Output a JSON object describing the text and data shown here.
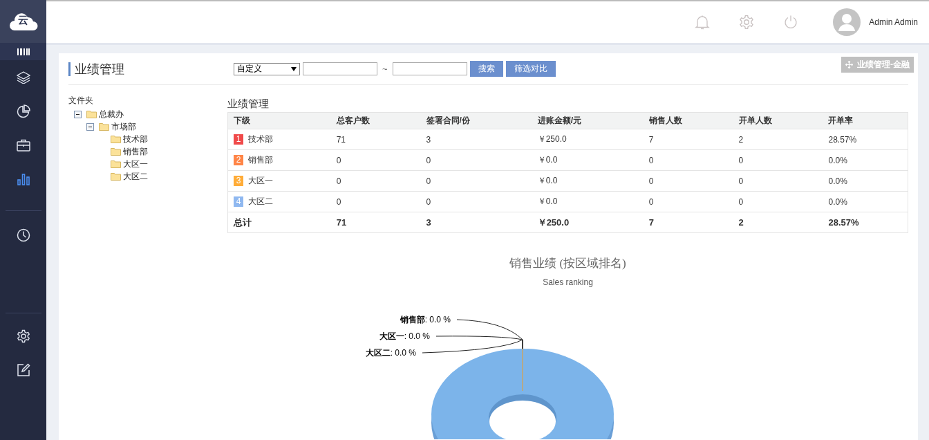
{
  "sidebar": {
    "logo_text": "云",
    "items": [
      {
        "kind": "barcode",
        "selected": false
      },
      {
        "kind": "layers",
        "selected": false
      },
      {
        "kind": "pie",
        "selected": false
      },
      {
        "kind": "briefcase",
        "selected": false
      },
      {
        "kind": "bars",
        "selected": true
      },
      {
        "kind": "clock",
        "selected": false
      },
      {
        "kind": "gear",
        "selected": false
      },
      {
        "kind": "edit",
        "selected": false
      }
    ]
  },
  "header": {
    "user_name": "Admin Admin"
  },
  "page": {
    "title": "业绩管理",
    "period_select": "自定义",
    "date_separator": "~",
    "buttons": [
      "搜索",
      "筛选对比"
    ],
    "tag": "业绩管理-金融"
  },
  "tree": {
    "label": "文件夹",
    "nodes": [
      {
        "name": "总裁办",
        "expanded": true,
        "children": [
          {
            "name": "市场部",
            "expanded": true,
            "children": [
              {
                "name": "技术部"
              },
              {
                "name": "销售部"
              },
              {
                "name": "大区一"
              },
              {
                "name": "大区二"
              }
            ]
          }
        ]
      }
    ]
  },
  "table": {
    "title": "业绩管理",
    "columns": [
      "下级",
      "总客户数",
      "签署合同/份",
      "进账金额/元",
      "销售人数",
      "开单人数",
      "开单率"
    ],
    "rows": [
      {
        "rank": "1",
        "color": "#f04a4a",
        "cells": [
          "技术部",
          "71",
          "3",
          "￥250.0",
          "7",
          "2",
          "28.57%"
        ]
      },
      {
        "rank": "2",
        "color": "#ff8547",
        "cells": [
          "销售部",
          "0",
          "0",
          "￥0.0",
          "0",
          "0",
          "0.0%"
        ]
      },
      {
        "rank": "3",
        "color": "#ffac38",
        "cells": [
          "大区一",
          "0",
          "0",
          "￥0.0",
          "0",
          "0",
          "0.0%"
        ]
      },
      {
        "rank": "4",
        "color": "#8fb8f0",
        "cells": [
          "大区二",
          "0",
          "0",
          "￥0.0",
          "0",
          "0",
          "0.0%"
        ]
      }
    ],
    "total": [
      "总计",
      "71",
      "3",
      "￥250.0",
      "7",
      "2",
      "28.57%"
    ]
  },
  "chart": {
    "title": "销售业绩 (按区域排名)",
    "subtitle": "Sales ranking",
    "labels": [
      {
        "name": "销售部",
        "value": ": 0.0 %"
      },
      {
        "name": "大区一",
        "value": ": 0.0 %"
      },
      {
        "name": "大区二",
        "value": ": 0.0 %"
      }
    ]
  }
}
